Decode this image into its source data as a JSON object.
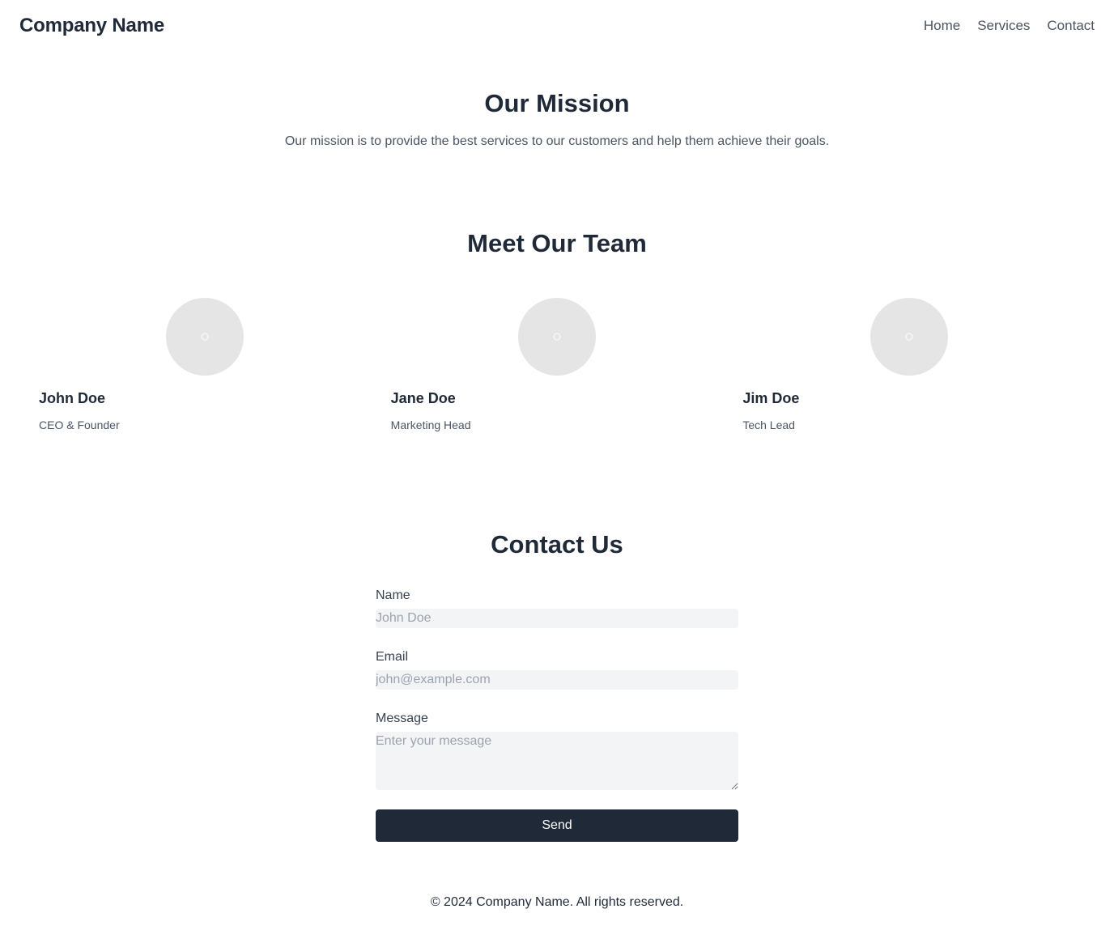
{
  "header": {
    "brand": "Company Name",
    "nav": [
      "Home",
      "Services",
      "Contact"
    ]
  },
  "mission": {
    "title": "Our Mission",
    "text": "Our mission is to provide the best services to our customers and help them achieve their goals."
  },
  "team": {
    "title": "Meet Our Team",
    "members": [
      {
        "name": "John Doe",
        "role": "CEO & Founder"
      },
      {
        "name": "Jane Doe",
        "role": "Marketing Head"
      },
      {
        "name": "Jim Doe",
        "role": "Tech Lead"
      }
    ]
  },
  "contact": {
    "title": "Contact Us",
    "name_label": "Name",
    "name_placeholder": "John Doe",
    "email_label": "Email",
    "email_placeholder": "john@example.com",
    "message_label": "Message",
    "message_placeholder": "Enter your message",
    "send_label": "Send"
  },
  "footer": {
    "text": "© 2024 Company Name. All rights reserved."
  }
}
